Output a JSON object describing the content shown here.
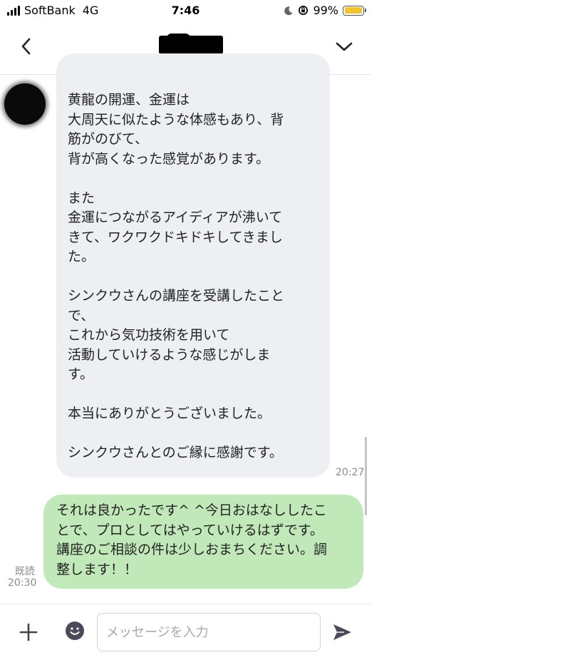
{
  "status_bar": {
    "carrier": "SoftBank",
    "network": "4G",
    "time": "7:46",
    "battery_percent": "99%",
    "battery_level": 0.99,
    "battery_color": "#f2c331",
    "icons": [
      "signal-icon",
      "moon-icon",
      "rotation-lock-icon",
      "battery-icon"
    ]
  },
  "header": {
    "title_redacted": true,
    "left_icon": "chevron-left-icon",
    "right_icon": "chevron-down-icon"
  },
  "messages": {
    "incoming": {
      "lines": [
        "黄龍の開運、金運は",
        "大周天に似たような体感もあり、背",
        "筋がのびて、",
        "背が高くなった感覚があります。",
        "",
        "また",
        "金運につながるアイディアが沸いて",
        "きて、ワクワクドキドキしてきまし",
        "た。",
        "",
        "シンクウさんの講座を受講したこと",
        "で、",
        "これから気功技術を用いて",
        "活動していけるような感じがしま",
        "す。",
        "",
        "本当にありがとうございました。",
        "",
        "シンクウさんとのご縁に感謝です。"
      ],
      "time": "20:27",
      "bubble_color": "#eeeff2"
    },
    "outgoing": {
      "lines": [
        "それは良かったです^ ^今日おはなししたこ",
        "とで、プロとしてはやっていけるはずです。",
        "講座のご相談の件は少しおまちください。調",
        "整します！！"
      ],
      "read_label": "既読",
      "time": "20:30",
      "bubble_color": "#c0e8b8"
    }
  },
  "input_bar": {
    "placeholder": "メッセージを入力",
    "icons": [
      "plus-icon",
      "emoji-icon",
      "send-icon"
    ]
  }
}
